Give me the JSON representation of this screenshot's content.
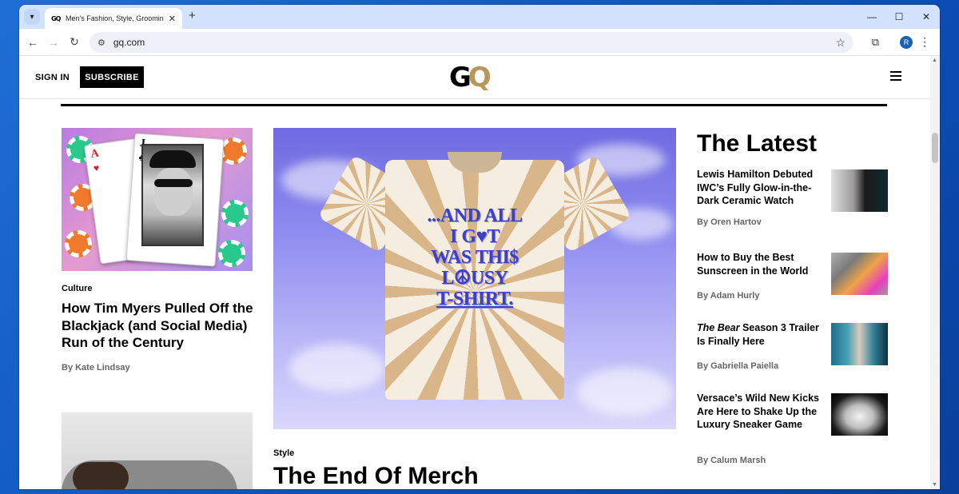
{
  "browser": {
    "tab_title": "Men's Fashion, Style, Grooming, Fi",
    "tab_favicon": "GQ",
    "url": "gq.com",
    "profile_initial": "R",
    "icons": {
      "tab_list": "chevron-down-icon",
      "new_tab": "plus-icon",
      "back": "arrow-left-icon",
      "forward": "arrow-right-icon",
      "reload": "reload-icon",
      "site_info": "tune-icon",
      "bookmark": "star-icon",
      "extensions": "puzzle-icon",
      "menu": "kebab-icon",
      "minimize": "minimize-icon",
      "maximize": "maximize-icon",
      "close": "close-icon"
    }
  },
  "header": {
    "sign_in": "SIGN IN",
    "subscribe": "SUBSCRIBE",
    "logo_g": "G",
    "logo_q": "Q",
    "logo_colors": {
      "g": "#000000",
      "q": "#b8975a"
    }
  },
  "left_story": {
    "section": "Culture",
    "headline": "How Tim Myers Pulled Off the Blackjack (and Social Media) Run of the Century",
    "byline": "By Kate Lindsay",
    "card_ace": "A",
    "card_ace_suit": "♥",
    "card_jack": "J",
    "card_jack_suit": "♣"
  },
  "center_story": {
    "section": "Style",
    "headline": "The End Of Merch",
    "shirt_lines": [
      "...AND ALL",
      "I G♥T",
      "WAS THI$",
      "L☮USY",
      "T-SHIRT."
    ]
  },
  "latest": {
    "title": "The Latest",
    "items": [
      {
        "headline": "Lewis Hamilton Debuted IWC’s Fully Glow-in-the-Dark Ceramic Watch",
        "byline": "By Oren Hartov"
      },
      {
        "headline": "How to Buy the Best Sunscreen in the World",
        "byline": "By Adam Hurly"
      },
      {
        "headline_em": "The Bear",
        "headline_rest": " Season 3 Trailer Is Finally Here",
        "byline": "By Gabriella Paiella"
      },
      {
        "headline": "Versace’s Wild New Kicks Are Here to Shake Up the Luxury Sneaker Game",
        "byline": "By Calum Marsh"
      }
    ]
  }
}
